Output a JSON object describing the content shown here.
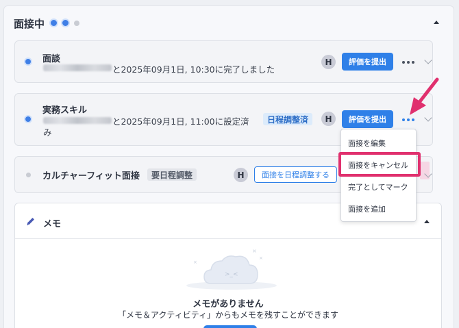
{
  "section": {
    "title": "面接中"
  },
  "interviews": [
    {
      "title": "面談",
      "subtitle": "と2025年09月1日, 10:30に完了しました",
      "avatar": "H",
      "action": "評価を提出"
    },
    {
      "title": "実務スキル",
      "subtitle_line1": "と2025年09月1日, 11:00に設定済",
      "subtitle_line2": "み",
      "tag": "日程調整済",
      "avatar": "H",
      "action": "評価を提出"
    },
    {
      "title": "カルチャーフィット面接",
      "tag": "要日程調整",
      "avatar": "H",
      "action": "面接を日程調整する"
    }
  ],
  "menu": {
    "items": [
      "面接を編集",
      "面接をキャンセル",
      "完了としてマーク",
      "面接を追加"
    ],
    "highlighted": "面接をキャンセル"
  },
  "memo": {
    "title": "メモ",
    "empty_title": "メモがありません",
    "empty_sub": "「メモ＆アクティビティ」からもメモを残すことができます"
  },
  "colors": {
    "accent": "#2f80e8",
    "highlight": "#e0306e"
  },
  "icons": [
    "chevron-up-icon",
    "chevron-down-icon",
    "more-icon",
    "pencil-icon",
    "cloud-icon",
    "arrow-icon"
  ]
}
